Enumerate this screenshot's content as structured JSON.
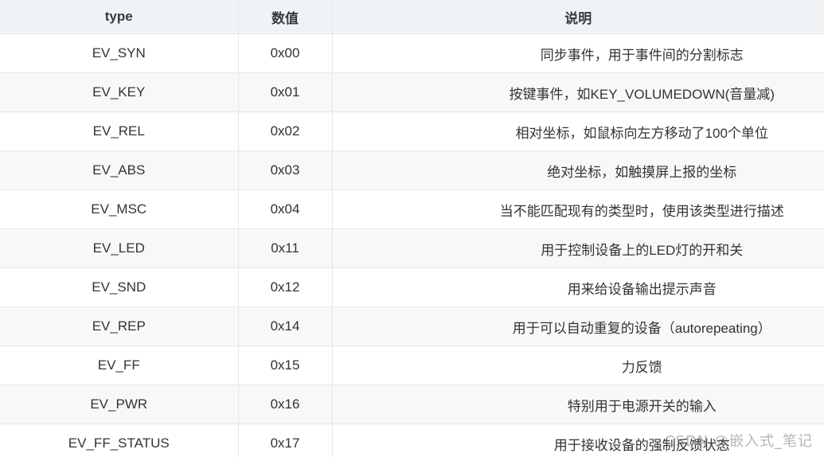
{
  "header": {
    "col_type": "type",
    "col_value": "数值",
    "col_desc": "说明"
  },
  "rows": [
    {
      "type": "EV_SYN",
      "value": "0x00",
      "desc": "同步事件，用于事件间的分割标志"
    },
    {
      "type": "EV_KEY",
      "value": "0x01",
      "desc": "按键事件，如KEY_VOLUMEDOWN(音量减)"
    },
    {
      "type": "EV_REL",
      "value": "0x02",
      "desc": "相对坐标，如鼠标向左方移动了100个单位"
    },
    {
      "type": "EV_ABS",
      "value": "0x03",
      "desc": "绝对坐标，如触摸屏上报的坐标"
    },
    {
      "type": "EV_MSC",
      "value": "0x04",
      "desc": "当不能匹配现有的类型时，使用该类型进行描述"
    },
    {
      "type": "EV_LED",
      "value": "0x11",
      "desc": "用于控制设备上的LED灯的开和关"
    },
    {
      "type": "EV_SND",
      "value": "0x12",
      "desc": "用来给设备输出提示声音"
    },
    {
      "type": "EV_REP",
      "value": "0x14",
      "desc": "用于可以自动重复的设备（autorepeating）"
    },
    {
      "type": "EV_FF",
      "value": "0x15",
      "desc": "力反馈"
    },
    {
      "type": "EV_PWR",
      "value": "0x16",
      "desc": "特别用于电源开关的输入"
    },
    {
      "type": "EV_FF_STATUS",
      "value": "0x17",
      "desc": "用于接收设备的强制反馈状态"
    }
  ],
  "watermark": "CSDN @嵌入式_笔记"
}
